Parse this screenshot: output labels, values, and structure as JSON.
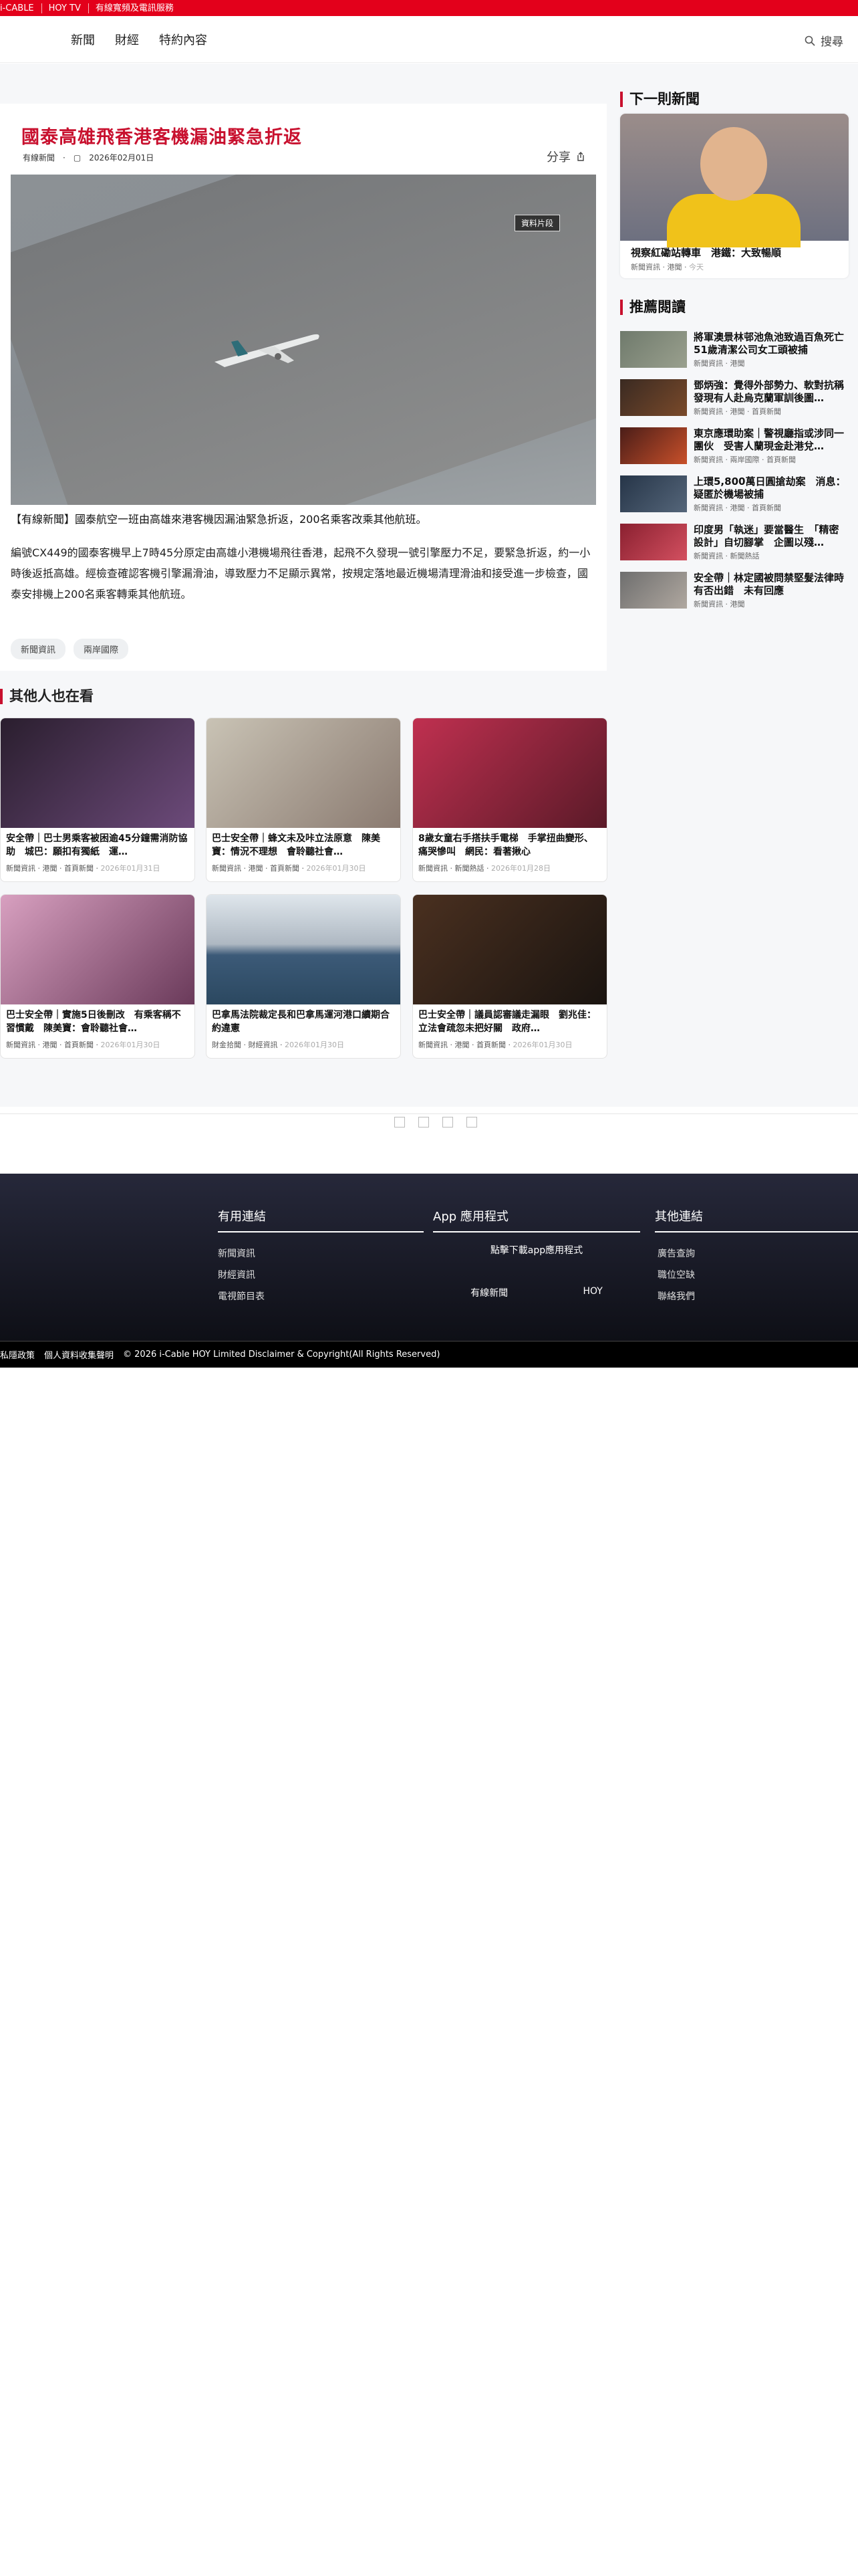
{
  "topbar": {
    "items": [
      "i-CABLE",
      "HOY TV",
      "有線寬頻及電訊服務"
    ]
  },
  "header": {
    "nav": [
      "新聞",
      "財經",
      "特約內容"
    ],
    "search_label": "搜尋"
  },
  "article": {
    "title": "國泰高雄飛香港客機漏油緊急折返",
    "source": "有線新聞",
    "date": "2026年02月01日",
    "share_label": "分享",
    "image_tag": "資料片段",
    "caption": "【有線新聞】國泰航空一班由高雄來港客機因漏油緊急折返，200名乘客改乘其他航班。",
    "body": "編號CX449的國泰客機早上7時45分原定由高雄小港機場飛往香港，起飛不久發現一號引擎壓力不足，要緊急折返，約一小時後返抵高雄。經檢查確認客機引擎漏滑油，導致壓力不足顯示異常，按規定落地最近機場清理滑油和接受進一步檢查，國泰安排機上200名乘客轉乘其他航班。",
    "tags": [
      "新聞資訊",
      "兩岸國際"
    ]
  },
  "next": {
    "heading": "下一則新聞",
    "title": "視察紅磡站轉車　港鐵：大致暢順",
    "meta": [
      "新聞資訊",
      "港聞",
      "今天"
    ]
  },
  "recommended": {
    "heading": "推薦閱讀",
    "items": [
      {
        "title": "將軍澳景林邨池魚池致過百魚死亡　51歲清潔公司女工頭被捕",
        "meta": "新聞資訊 · 港聞"
      },
      {
        "title": "鄧炳強：覺得外部勢力、軟對抗稱發現有人赴烏克蘭軍訓後圖…",
        "meta": "新聞資訊 · 港聞 · 首頁新聞"
      },
      {
        "title": "東京應環助案｜警視廳指或涉同一團伙　受害人蘭現金赴港兌…",
        "meta": "新聞資訊 · 兩岸國際 · 首頁新聞"
      },
      {
        "title": "上環5,800萬日圓搶劫案　消息：疑匿於機場被捕",
        "meta": "新聞資訊 · 港聞 · 首頁新聞"
      },
      {
        "title": "印度男「執迷」要當醫生　「精密設計」自切腳掌　企圖以殘…",
        "meta": "新聞資訊 · 新聞熱話"
      },
      {
        "title": "安全帶｜林定國被問禁堅髮法律時有否出錯　未有回應",
        "meta": "新聞資訊 · 港聞"
      }
    ]
  },
  "others": {
    "heading": "其他人也在看",
    "cards": [
      {
        "title": "安全帶｜巴士男乘客被困逾45分鐘需消防協助　城巴：願扣有獨紙　運…",
        "meta": "新聞資訊 · 港聞 · 首頁新聞",
        "date": "2026年01月31日"
      },
      {
        "title": "巴士安全帶｜蜂文未及咔立法原意　陳美寶：情況不理想　會聆聽社會…",
        "meta": "新聞資訊 · 港聞 · 首頁新聞",
        "date": "2026年01月30日"
      },
      {
        "title": "8歲女童右手搭扶手電梯　手掌扭曲變形、痛哭慘叫　網民：看著揪心",
        "meta": "新聞資訊 · 新聞熱話",
        "date": "2026年01月28日"
      },
      {
        "title": "巴士安全帶｜實施5日後刪改　有乘客稱不習慣戴　陳美寶：會聆聽社會…",
        "meta": "新聞資訊 · 港聞 · 首頁新聞",
        "date": "2026年01月30日"
      },
      {
        "title": "巴拿馬法院裁定長和巴拿馬運河港口續期合約違憲",
        "meta": "財金拾聞 · 財經資訊",
        "date": "2026年01月30日"
      },
      {
        "title": "巴士安全帶｜議員認審議走漏眼　劉兆佳：立法會疏忽未把好關　政府…",
        "meta": "新聞資訊 · 港聞 · 首頁新聞",
        "date": "2026年01月30日"
      }
    ]
  },
  "footer": {
    "col1": {
      "heading": "有用連結",
      "links": [
        "新聞資訊",
        "財經資訊",
        "電視節目表"
      ]
    },
    "col2": {
      "heading": "App 應用程式",
      "download": "點擊下載app應用程式",
      "apps": [
        "有線新聞",
        "HOY"
      ]
    },
    "col3": {
      "heading": "其他連結",
      "links": [
        "廣告查詢",
        "職位空缺",
        "聯絡我們"
      ]
    },
    "bottom": [
      "私隱政策",
      "個人資料收集聲明",
      "© 2026 i-Cable HOY Limited Disclaimer & Copyright(All Rights Reserved)"
    ]
  },
  "colors": {
    "brand_red": "#e3001b",
    "title_red": "#c8102e",
    "footer_dark": "#15161f"
  }
}
